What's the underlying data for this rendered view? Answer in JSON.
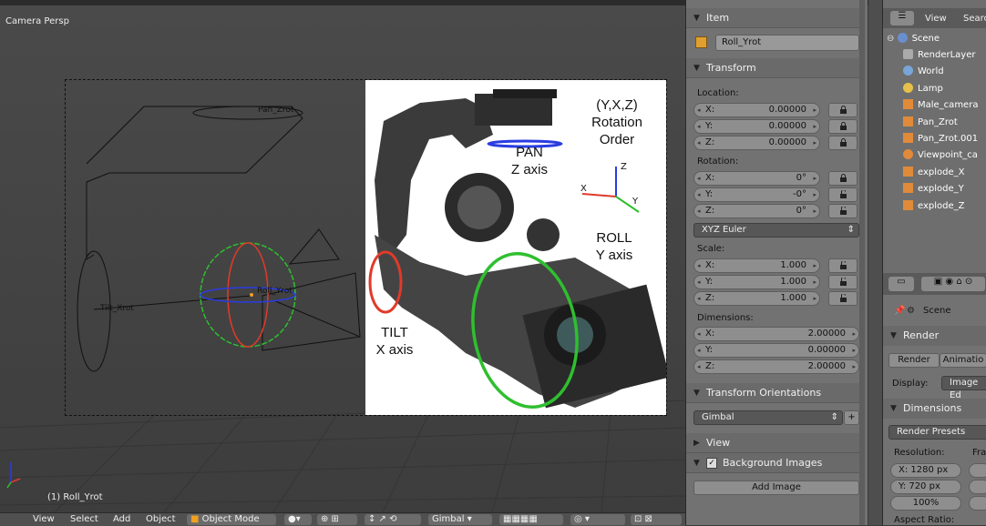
{
  "viewport": {
    "title": "Camera Persp",
    "active_object": "(1) Roll_Yrot",
    "labels": {
      "pan": "Pan_Zrot",
      "tilt": "Tilt_Xrot",
      "roll": "Roll_Yrot"
    }
  },
  "photo": {
    "rotation_order": [
      "(Y,X,Z)",
      "Rotation",
      "Order"
    ],
    "pan": [
      "PAN",
      "Z axis"
    ],
    "roll": [
      "ROLL",
      "Y axis"
    ],
    "tilt": [
      "TILT",
      "X axis"
    ],
    "axis_x": "X",
    "axis_y": "Y",
    "axis_z": "Z"
  },
  "bottom_bar": {
    "view": "View",
    "select": "Select",
    "add": "Add",
    "object": "Object",
    "mode": "Object Mode",
    "orientation": "Gimbal"
  },
  "properties": {
    "item_header": "Item",
    "object_name": "Roll_Yrot",
    "transform_header": "Transform",
    "location_label": "Location:",
    "location": [
      {
        "axis": "X:",
        "value": "0.00000"
      },
      {
        "axis": "Y:",
        "value": "0.00000"
      },
      {
        "axis": "Z:",
        "value": "0.00000"
      }
    ],
    "rotation_label": "Rotation:",
    "rotation": [
      {
        "axis": "X:",
        "value": "0°"
      },
      {
        "axis": "Y:",
        "value": "-0°"
      },
      {
        "axis": "Z:",
        "value": "0°"
      }
    ],
    "rotation_mode": "XYZ Euler",
    "scale_label": "Scale:",
    "scale": [
      {
        "axis": "X:",
        "value": "1.000"
      },
      {
        "axis": "Y:",
        "value": "1.000"
      },
      {
        "axis": "Z:",
        "value": "1.000"
      }
    ],
    "dimensions_label": "Dimensions:",
    "dimensions": [
      {
        "axis": "X:",
        "value": "2.00000"
      },
      {
        "axis": "Y:",
        "value": "0.00000"
      },
      {
        "axis": "Z:",
        "value": "2.00000"
      }
    ],
    "transform_orientations_header": "Transform Orientations",
    "orientation_value": "Gimbal",
    "view_header": "View",
    "background_images_header": "Background Images",
    "add_image": "Add Image"
  },
  "outliner": {
    "view": "View",
    "search": "Searc",
    "items": [
      "Scene",
      "RenderLayer",
      "World",
      "Lamp",
      "Male_camera",
      "Pan_Zrot",
      "Pan_Zrot.001",
      "Viewpoint_ca",
      "explode_X",
      "explode_Y",
      "explode_Z"
    ]
  },
  "render_panel": {
    "context": "Scene",
    "render_header": "Render",
    "render_button": "Render",
    "animation_button": "Animatio",
    "display_label": "Display:",
    "display_value": "Image Ed",
    "dimensions_header": "Dimensions",
    "render_presets": "Render Presets",
    "resolution_label": "Resolution:",
    "res_x": "X: 1280 px",
    "res_y": "Y:  720 px",
    "res_percent": "100%",
    "fr_label": "Fra",
    "aspect_label": "Aspect Ratio:"
  },
  "colors": {
    "x_axis": "#e03a2a",
    "y_axis": "#2fbf2f",
    "z_axis": "#2a3ce0",
    "object_origin": "#f0a020"
  }
}
